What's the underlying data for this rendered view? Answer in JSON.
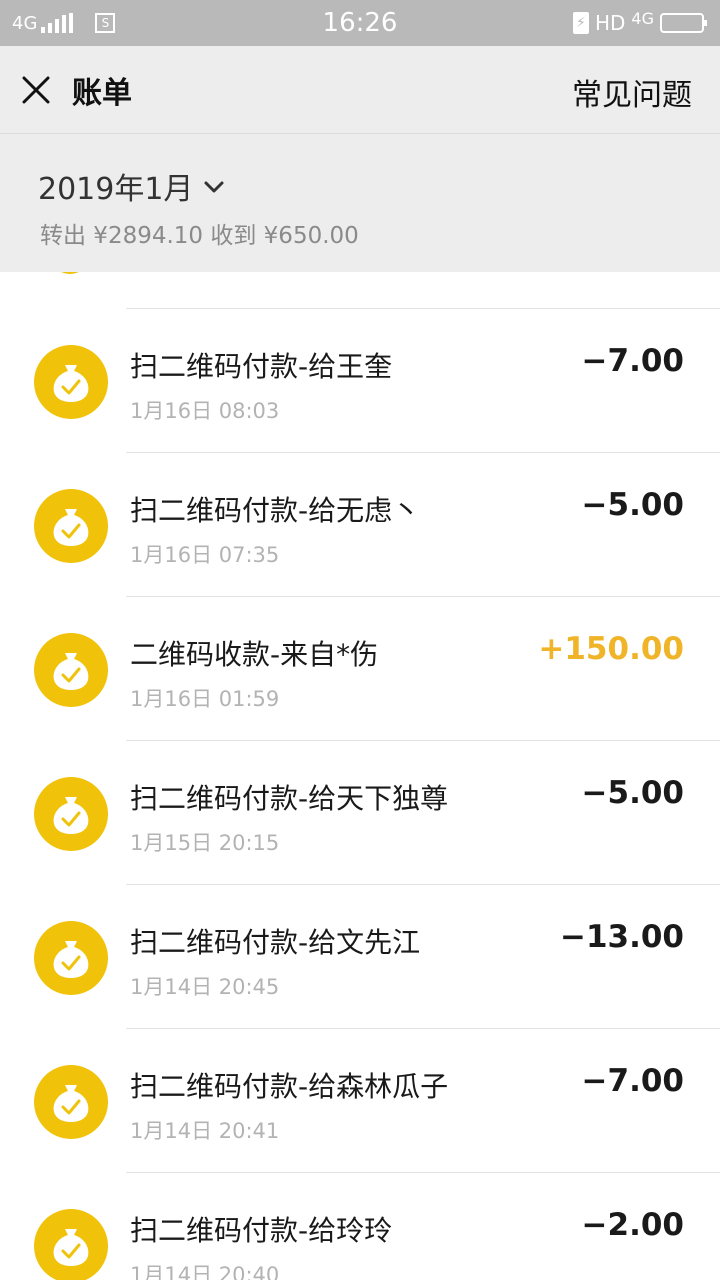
{
  "status_bar": {
    "network": "4G",
    "time": "16:26",
    "hd": "HD",
    "network_right": "4G"
  },
  "nav": {
    "title": "账单",
    "faq": "常见问题"
  },
  "month": {
    "label": "2019年1月",
    "summary": "转出 ¥2894.10 收到 ¥650.00"
  },
  "transactions": [
    {
      "title": "扫二维码付款-给王奎",
      "time": "1月16日 08:03",
      "amount": "−7.00"
    },
    {
      "title": "扫二维码付款-给无虑丶",
      "time": "1月16日 07:35",
      "amount": "−5.00"
    },
    {
      "title": "二维码收款-来自*伤",
      "time": "1月16日 01:59",
      "amount": "+150.00"
    },
    {
      "title": "扫二维码付款-给天下独尊",
      "time": "1月15日 20:15",
      "amount": "−5.00"
    },
    {
      "title": "扫二维码付款-给文先江",
      "time": "1月14日 20:45",
      "amount": "−13.00"
    },
    {
      "title": "扫二维码付款-给森林瓜子",
      "time": "1月14日 20:41",
      "amount": "−7.00"
    },
    {
      "title": "扫二维码付款-给玲玲",
      "time": "1月14日 20:40",
      "amount": "−2.00"
    }
  ],
  "colors": {
    "icon_bg": "#f0c20a",
    "income": "#f0b429",
    "header_bg": "#ededed"
  }
}
